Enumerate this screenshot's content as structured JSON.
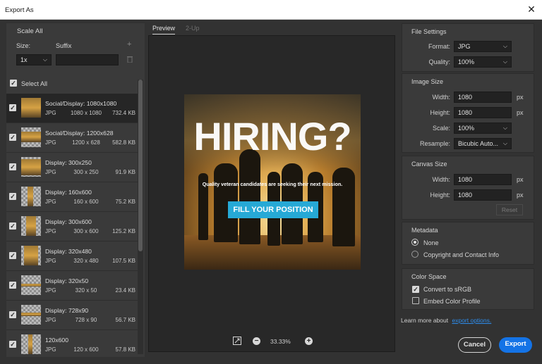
{
  "window": {
    "title": "Export As",
    "close_glyph": "✕"
  },
  "scale": {
    "heading": "Scale All",
    "size_label": "Size:",
    "suffix_label": "Suffix",
    "size_value": "1x",
    "suffix_value": "",
    "add_glyph": "+",
    "delete_icon": "trash-icon"
  },
  "select_all": {
    "label": "Select All",
    "checked": true
  },
  "files": [
    {
      "name": "Social/Display: 1080x1080",
      "format": "JPG",
      "dims": "1080 x 1080",
      "size": "732.4 KB"
    },
    {
      "name": "Social/Display: 1200x628",
      "format": "JPG",
      "dims": "1200 x 628",
      "size": "582.8 KB"
    },
    {
      "name": "Display: 300x250",
      "format": "JPG",
      "dims": "300 x 250",
      "size": "91.9 KB"
    },
    {
      "name": "Display: 160x600",
      "format": "JPG",
      "dims": "160 x 600",
      "size": "75.2 KB"
    },
    {
      "name": "Display: 300x600",
      "format": "JPG",
      "dims": "300 x 600",
      "size": "125.2 KB"
    },
    {
      "name": "Display: 320x480",
      "format": "JPG",
      "dims": "320 x 480",
      "size": "107.5 KB"
    },
    {
      "name": "Display: 320x50",
      "format": "JPG",
      "dims": "320 x 50",
      "size": "23.4 KB"
    },
    {
      "name": "Display: 728x90",
      "format": "JPG",
      "dims": "728 x 90",
      "size": "56.7 KB"
    },
    {
      "name": "120x600",
      "format": "JPG",
      "dims": "120 x 600",
      "size": "57.8 KB"
    }
  ],
  "tabs": {
    "preview": "Preview",
    "two_up": "2-Up"
  },
  "preview": {
    "headline": "HIRING?",
    "subline": "Quality veteran candidates are seeking their next mission.",
    "cta": "FILL YOUR POSITION"
  },
  "zoom": {
    "value": "33.33%",
    "minus": "−",
    "plus": "+"
  },
  "file_settings": {
    "heading": "File Settings",
    "format_label": "Format:",
    "format_value": "JPG",
    "quality_label": "Quality:",
    "quality_value": "100%"
  },
  "image_size": {
    "heading": "Image Size",
    "width_label": "Width:",
    "width_value": "1080",
    "height_label": "Height:",
    "height_value": "1080",
    "scale_label": "Scale:",
    "scale_value": "100%",
    "resample_label": "Resample:",
    "resample_value": "Bicubic Auto...",
    "unit": "px"
  },
  "canvas_size": {
    "heading": "Canvas Size",
    "width_label": "Width:",
    "width_value": "1080",
    "height_label": "Height:",
    "height_value": "1080",
    "unit": "px",
    "reset_label": "Reset"
  },
  "metadata": {
    "heading": "Metadata",
    "options": [
      "None",
      "Copyright and Contact Info"
    ],
    "selected": "None"
  },
  "color_space": {
    "heading": "Color Space",
    "convert_label": "Convert to sRGB",
    "convert_checked": true,
    "embed_label": "Embed Color Profile",
    "embed_checked": false
  },
  "learn_more": {
    "text": "Learn more about",
    "link": "export options."
  },
  "buttons": {
    "cancel": "Cancel",
    "export": "Export"
  },
  "colors": {
    "accent": "#1473e6",
    "panel": "#3a3a3a",
    "background": "#323232",
    "cta": "#26a9d6"
  }
}
